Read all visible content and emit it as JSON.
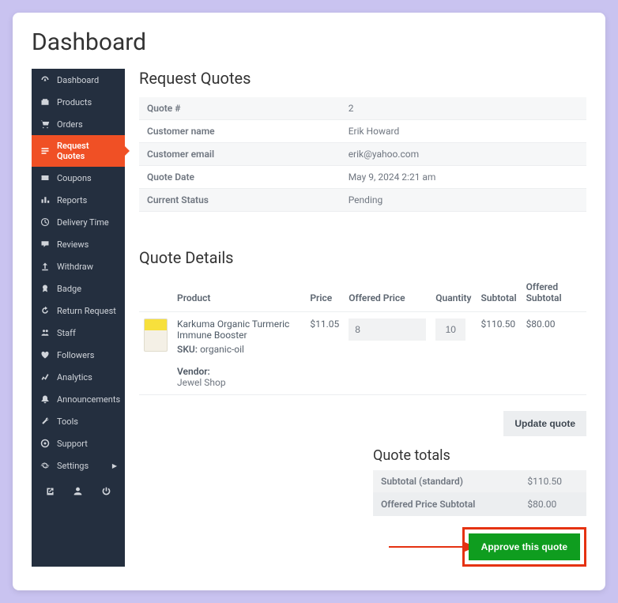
{
  "page_title": "Dashboard",
  "sidebar": {
    "items": [
      {
        "label": "Dashboard",
        "icon": "dashboard-icon"
      },
      {
        "label": "Products",
        "icon": "products-icon"
      },
      {
        "label": "Orders",
        "icon": "orders-icon"
      },
      {
        "label": "Request Quotes",
        "icon": "quotes-icon"
      },
      {
        "label": "Coupons",
        "icon": "coupons-icon"
      },
      {
        "label": "Reports",
        "icon": "reports-icon"
      },
      {
        "label": "Delivery Time",
        "icon": "clock-icon"
      },
      {
        "label": "Reviews",
        "icon": "reviews-icon"
      },
      {
        "label": "Withdraw",
        "icon": "withdraw-icon"
      },
      {
        "label": "Badge",
        "icon": "badge-icon"
      },
      {
        "label": "Return Request",
        "icon": "return-icon"
      },
      {
        "label": "Staff",
        "icon": "staff-icon"
      },
      {
        "label": "Followers",
        "icon": "followers-icon"
      },
      {
        "label": "Analytics",
        "icon": "analytics-icon"
      },
      {
        "label": "Announcements",
        "icon": "announcements-icon"
      },
      {
        "label": "Tools",
        "icon": "tools-icon"
      },
      {
        "label": "Support",
        "icon": "support-icon"
      },
      {
        "label": "Settings",
        "icon": "settings-icon",
        "has_caret": true
      }
    ]
  },
  "sections": {
    "request_quotes_title": "Request Quotes",
    "quote_details_title": "Quote Details",
    "quote_totals_title": "Quote totals"
  },
  "quote_info": {
    "rows": [
      {
        "label": "Quote #",
        "value": "2"
      },
      {
        "label": "Customer name",
        "value": "Erik Howard"
      },
      {
        "label": "Customer email",
        "value": "erik@yahoo.com"
      },
      {
        "label": "Quote Date",
        "value": "May 9, 2024 2:21 am"
      },
      {
        "label": "Current Status",
        "value": "Pending"
      }
    ]
  },
  "details": {
    "headers": {
      "product": "Product",
      "price": "Price",
      "offered_price": "Offered Price",
      "quantity": "Quantity",
      "subtotal": "Subtotal",
      "offered_subtotal": "Offered Subtotal"
    },
    "item": {
      "name": "Karkuma Organic Turmeric Immune Booster",
      "sku_label": "SKU:",
      "sku": "organic-oil",
      "vendor_label": "Vendor:",
      "vendor": "Jewel Shop",
      "price": "$11.05",
      "offered_price": "8",
      "quantity": "10",
      "subtotal": "$110.50",
      "offered_subtotal": "$80.00"
    }
  },
  "totals": {
    "rows": [
      {
        "label": "Subtotal (standard)",
        "value": "$110.50"
      },
      {
        "label": "Offered Price Subtotal",
        "value": "$80.00"
      }
    ]
  },
  "buttons": {
    "update": "Update quote",
    "approve": "Approve this quote"
  }
}
